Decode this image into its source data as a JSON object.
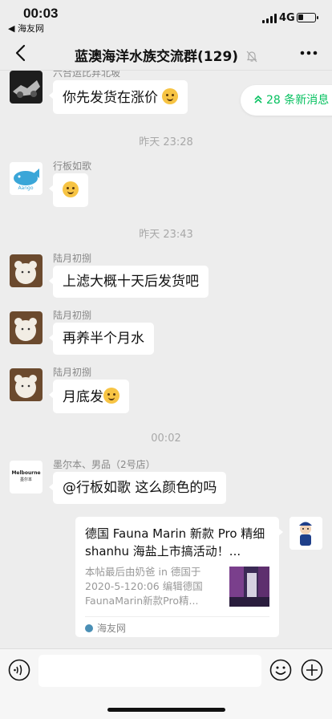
{
  "status_bar": {
    "time": "00:03",
    "back_app": "◀ 海友网",
    "network": "4G"
  },
  "nav": {
    "title": "蓝澳海洋水族交流群(129)"
  },
  "new_messages": "28 条新消息",
  "messages": [
    {
      "sender": "六合运比弃北坡",
      "text": "你先发货在涨价"
    },
    {
      "timestamp": "昨天 23:28"
    },
    {
      "sender": "行板如歌",
      "text": ""
    },
    {
      "timestamp": "昨天 23:43"
    },
    {
      "sender": "陆月初捌",
      "text": "上滤大概十天后发货吧"
    },
    {
      "sender": "陆月初捌",
      "text": "再养半个月水"
    },
    {
      "sender": "陆月初捌",
      "text": "月底发"
    },
    {
      "timestamp": "00:02"
    },
    {
      "sender": "墨尔本、男品（2号店）",
      "avatar_label": "Melbourne",
      "avatar_sub": "墨尔本",
      "text": "@行板如歌 这么颜色的吗"
    }
  ],
  "link_card": {
    "title": "德国 Fauna Marin 新款 Pro 精细 shanhu 海盐上市搞活动！...",
    "description": "本帖最后由奶爸 in 德国于 2020-5-120:06 编辑德国 FaunaMarin新款Pro精...",
    "source": "海友网"
  },
  "colors": {
    "background": "#ededed",
    "accent_green": "#07c160",
    "bubble": "#ffffff"
  }
}
